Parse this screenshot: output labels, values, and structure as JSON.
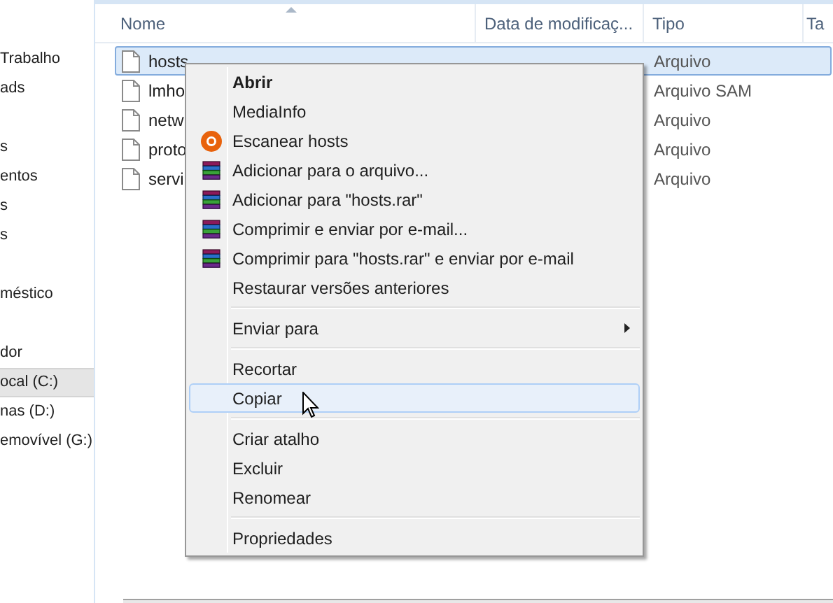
{
  "sidebar": {
    "groups": [
      {
        "items": [
          {
            "label": "Trabalho",
            "selected": false
          },
          {
            "label": "ads",
            "selected": false
          }
        ]
      },
      {
        "items": [
          {
            "label": "s",
            "selected": false
          },
          {
            "label": "entos",
            "selected": false
          },
          {
            "label": "s",
            "selected": false
          },
          {
            "label": "s",
            "selected": false
          }
        ]
      },
      {
        "items": [
          {
            "label": "méstico",
            "selected": false
          }
        ]
      },
      {
        "items": [
          {
            "label": "dor",
            "selected": false
          },
          {
            "label": "ocal (C:)",
            "selected": true
          },
          {
            "label": "nas (D:)",
            "selected": false
          },
          {
            "label": "emovível (G:)",
            "selected": false
          }
        ]
      }
    ]
  },
  "table": {
    "columns": [
      "Nome",
      "Data de modificaç...",
      "Tipo",
      "Ta"
    ],
    "rows": [
      {
        "name": "hosts",
        "type": "Arquivo",
        "selected": true
      },
      {
        "name": "lmho",
        "type": "Arquivo SAM",
        "selected": false
      },
      {
        "name": "netw",
        "type": "Arquivo",
        "selected": false
      },
      {
        "name": "proto",
        "type": "Arquivo",
        "selected": false
      },
      {
        "name": "servi",
        "type": "Arquivo",
        "selected": false
      }
    ]
  },
  "context_menu": {
    "groups": [
      {
        "items": [
          {
            "label": "Abrir",
            "kind": "plain",
            "default": true,
            "hovered": false
          },
          {
            "label": "MediaInfo",
            "kind": "plain",
            "default": false,
            "hovered": false
          },
          {
            "label": "Escanear hosts",
            "kind": "scan",
            "default": false,
            "hovered": false
          },
          {
            "label": "Adicionar para o arquivo...",
            "kind": "archive",
            "default": false,
            "hovered": false
          },
          {
            "label": "Adicionar para \"hosts.rar\"",
            "kind": "archive",
            "default": false,
            "hovered": false
          },
          {
            "label": "Comprimir e enviar por e-mail...",
            "kind": "archive",
            "default": false,
            "hovered": false
          },
          {
            "label": "Comprimir para \"hosts.rar\" e enviar por e-mail",
            "kind": "archive",
            "default": false,
            "hovered": false
          },
          {
            "label": "Restaurar versões anteriores",
            "kind": "plain",
            "default": false,
            "hovered": false
          }
        ]
      },
      {
        "items": [
          {
            "label": "Enviar para",
            "kind": "submenu",
            "default": false,
            "hovered": false
          }
        ]
      },
      {
        "items": [
          {
            "label": "Recortar",
            "kind": "plain",
            "default": false,
            "hovered": false
          },
          {
            "label": "Copiar",
            "kind": "plain",
            "default": false,
            "hovered": true
          }
        ]
      },
      {
        "items": [
          {
            "label": "Criar atalho",
            "kind": "plain",
            "default": false,
            "hovered": false
          },
          {
            "label": "Excluir",
            "kind": "plain",
            "default": false,
            "hovered": false
          },
          {
            "label": "Renomear",
            "kind": "plain",
            "default": false,
            "hovered": false
          }
        ]
      },
      {
        "items": [
          {
            "label": "Propriedades",
            "kind": "plain",
            "default": false,
            "hovered": false
          }
        ]
      }
    ]
  }
}
